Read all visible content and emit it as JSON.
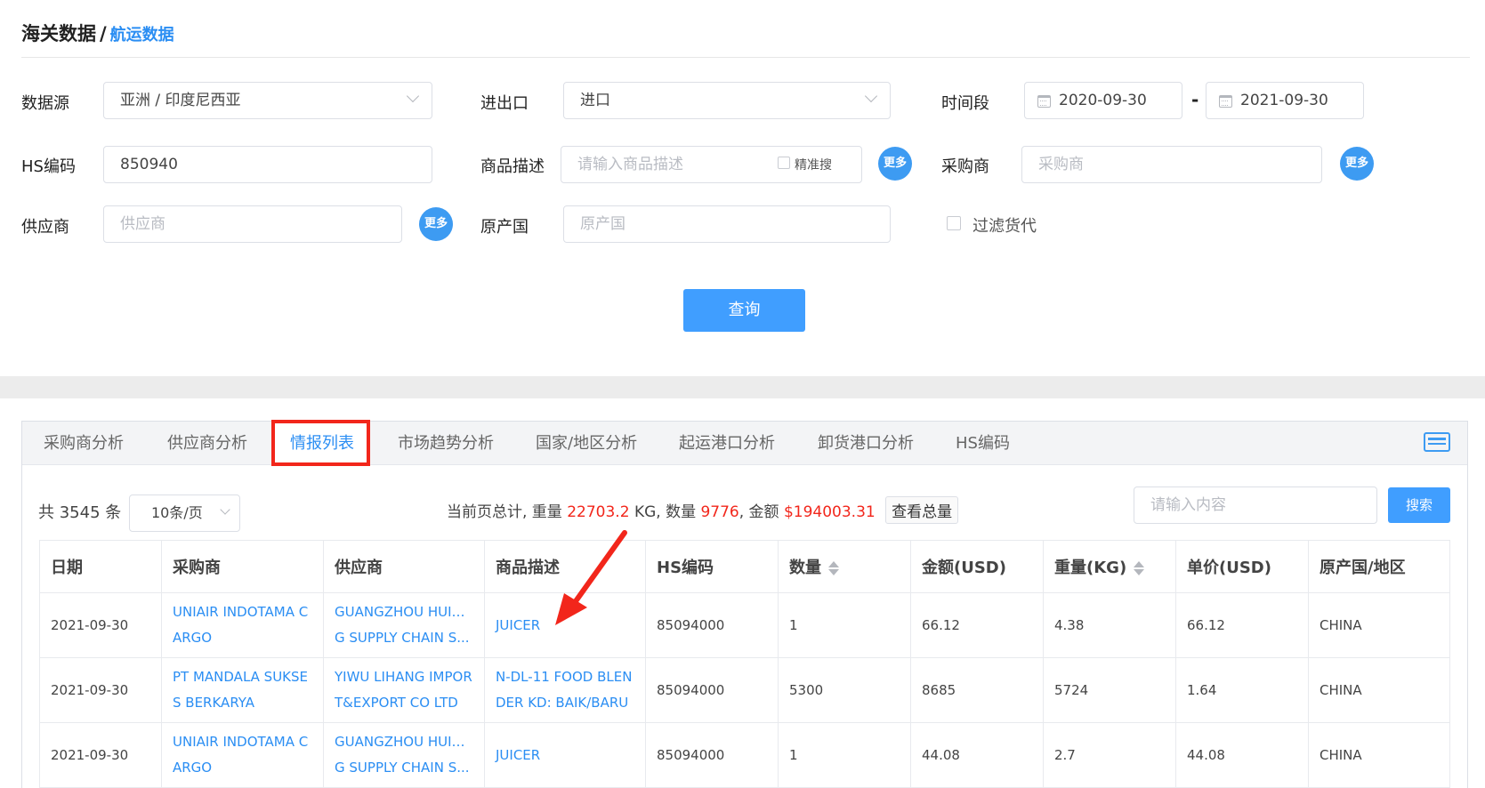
{
  "header": {
    "title": "海关数据",
    "separator": "/",
    "subtitle": "航运数据"
  },
  "filters": {
    "source": {
      "label": "数据源",
      "value": "亚洲 / 印度尼西亚"
    },
    "direction": {
      "label": "进出口",
      "value": "进口"
    },
    "period": {
      "label": "时间段",
      "start": "2020-09-30",
      "separator": "-",
      "end": "2021-09-30"
    },
    "hs": {
      "label": "HS编码",
      "value": "850940"
    },
    "product": {
      "label": "商品描述",
      "placeholder": "请输入商品描述",
      "exact_label": "精准搜"
    },
    "buyer": {
      "label": "采购商",
      "placeholder": "采购商"
    },
    "supplier": {
      "label": "供应商",
      "placeholder": "供应商"
    },
    "origin": {
      "label": "原产国",
      "placeholder": "原产国"
    },
    "forwarder": {
      "label": "过滤货代"
    },
    "more_label": "更多",
    "query_label": "查询"
  },
  "tabs": [
    {
      "label": "采购商分析",
      "active": false
    },
    {
      "label": "供应商分析",
      "active": false
    },
    {
      "label": "情报列表",
      "active": true
    },
    {
      "label": "市场趋势分析",
      "active": false
    },
    {
      "label": "国家/地区分析",
      "active": false
    },
    {
      "label": "起运港口分析",
      "active": false
    },
    {
      "label": "卸货港口分析",
      "active": false
    },
    {
      "label": "HS编码",
      "active": false
    }
  ],
  "toolbar": {
    "total_text": "共 3545 条",
    "page_size": "10条/页",
    "summary_prefix": "当前页总计, 重量",
    "weight": "22703.2",
    "weight_unit": "KG, 数量",
    "quantity": "9776",
    "amount_prefix": ", 金额",
    "amount": "$194003.31",
    "view_total": "查看总量",
    "search_placeholder": "请输入内容",
    "search_label": "搜索"
  },
  "table": {
    "columns": [
      "日期",
      "采购商",
      "供应商",
      "商品描述",
      "HS编码",
      "数量",
      "金额(USD)",
      "重量(KG)",
      "单价(USD)",
      "原产国/地区"
    ],
    "rows": [
      {
        "date": "2021-09-30",
        "buyer": "UNIAIR INDOTAMA C ARGO",
        "supplier_1": "GUANGZHOU HUIXIN",
        "supplier_2": "G SUPPLY CHAIN S...",
        "product": "JUICER",
        "hs": "85094000",
        "qty": "1",
        "amount": "66.12",
        "weight": "4.38",
        "unit_price": "66.12",
        "origin": "CHINA"
      },
      {
        "date": "2021-09-30",
        "buyer": "PT MANDALA SUKSE S BERKARYA",
        "supplier_1": "YIWU LIHANG IMPOR",
        "supplier_2": "T&EXPORT CO LTD",
        "product": "N-DL-11 FOOD BLEN DER KD: BAIK/BARU",
        "hs": "85094000",
        "qty": "5300",
        "amount": "8685",
        "weight": "5724",
        "unit_price": "1.64",
        "origin": "CHINA"
      },
      {
        "date": "2021-09-30",
        "buyer": "UNIAIR INDOTAMA C ARGO",
        "supplier_1": "GUANGZHOU HUIXIN",
        "supplier_2": "G SUPPLY CHAIN S...",
        "product": "JUICER",
        "hs": "85094000",
        "qty": "1",
        "amount": "44.08",
        "weight": "2.7",
        "unit_price": "44.08",
        "origin": "CHINA"
      }
    ]
  },
  "colors": {
    "accent": "#409eff",
    "link": "#2b8ef3",
    "highlight": "#f2261b"
  },
  "icons": {
    "dropdown": "chevron-down-icon",
    "calendar": "calendar-icon",
    "print": "print-icon",
    "sort": "sort-icon",
    "annotation": "red-arrow-icon"
  }
}
